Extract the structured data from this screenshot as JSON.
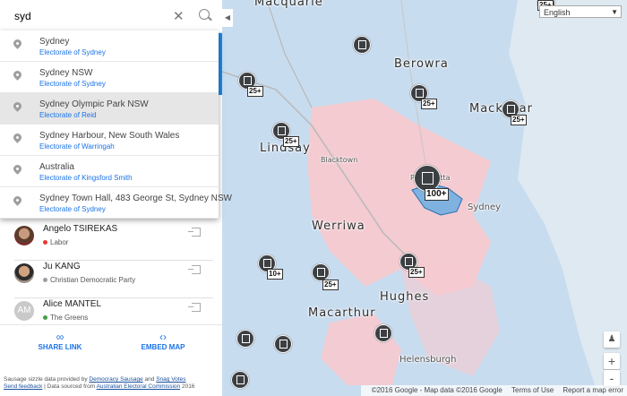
{
  "search": {
    "value": "syd",
    "clear_icon": "close-icon",
    "search_icon": "search-icon"
  },
  "suggestions": [
    {
      "title": "Sydney",
      "subtitle": "Electorate of Sydney"
    },
    {
      "title": "Sydney NSW",
      "subtitle": "Electorate of Sydney"
    },
    {
      "title": "Sydney Olympic Park NSW",
      "subtitle": "Electorate of Reid"
    },
    {
      "title": "Sydney Harbour, New South Wales",
      "subtitle": "Electorate of Warringah"
    },
    {
      "title": "Australia",
      "subtitle": "Electorate of Kingsford Smith"
    },
    {
      "title": "Sydney Town Hall, 483 George St, Sydney NSW",
      "subtitle": "Electorate of Sydney"
    }
  ],
  "candidates": [
    {
      "name": "Angelo TSIREKAS",
      "party": "Labor",
      "party_color": "#e53935"
    },
    {
      "name": "Ju KANG",
      "party": "Christian Democratic Party",
      "party_color": "#9e9e9e"
    },
    {
      "name": "Alice MANTEL",
      "party": "The Greens",
      "party_color": "#43a047",
      "initials": "AM"
    }
  ],
  "actions": {
    "share_label": "SHARE LINK",
    "embed_label": "EMBED MAP"
  },
  "footer": {
    "line1_pre": "Sausage sizzle data provided by ",
    "democracy_sausage": "Democracy Sausage",
    "and": " and ",
    "snag_votes": "Snag Votes",
    "feedback": "Send feedback",
    "line2_mid": " | Data sourced from ",
    "aec": "Australian Electoral Commission",
    "year": " 2016"
  },
  "map": {
    "language": "English",
    "places": {
      "macquarie": "Macquarie",
      "berowra": "Berowra",
      "mackellar": "Mackellar",
      "lindsay": "Lindsay",
      "werriwa": "Werriwa",
      "sydney": "Sydney",
      "hughes": "Hughes",
      "macarthur": "Macarthur",
      "helensburgh": "Helensburgh",
      "parramatta": "Parramatta",
      "blacktown": "Blacktown"
    },
    "counts": [
      "25+",
      "25+",
      "25+",
      "25+",
      "100+",
      "10+",
      "25+",
      "25+",
      "25+"
    ],
    "attribution": "©2016 Google - Map data ©2016 Google",
    "terms": "Terms of Use",
    "report": "Report a map error",
    "zoom_in": "+",
    "zoom_out": "-",
    "colors": {
      "water": "#dfe9f1",
      "red_electorate": "#f6c9cf",
      "blue_electorate": "#c8dcef",
      "highlight": "#7fb2df"
    }
  }
}
